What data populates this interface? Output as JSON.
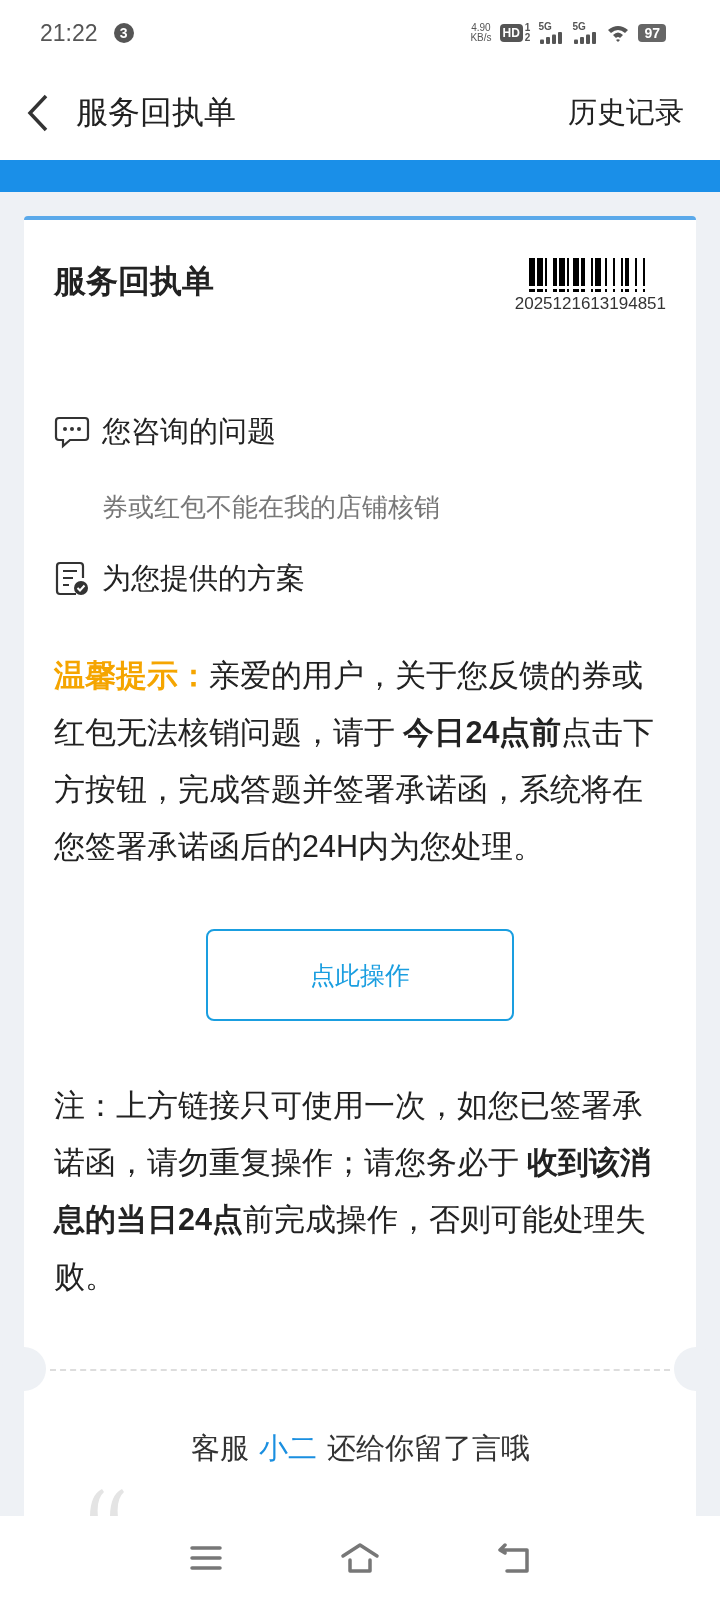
{
  "status_bar": {
    "time": "21:22",
    "notification_count": "3",
    "net_speed": "4.90",
    "net_unit": "KB/s",
    "hd": "HD",
    "sim_slots": [
      "1",
      "2"
    ],
    "networks": [
      "5G",
      "5G"
    ],
    "battery": "97"
  },
  "header": {
    "title": "服务回执单",
    "history_link": "历史记录"
  },
  "card": {
    "title": "服务回执单",
    "receipt_number": "2025121613194851",
    "sections": [
      {
        "kind": "question",
        "heading": "您咨询的问题",
        "answer": "券或红包不能在我的店铺核销"
      },
      {
        "kind": "solution",
        "heading": "为您提供的方案"
      }
    ],
    "tip": {
      "label": "温馨提示：",
      "text": "亲爱的用户，关于您反馈的券或红包无法核销问题，请于 **今日24点前**点击下方按钮，完成答题并签署承诺函，系统将在您签署承诺函后的24H内为您处理。"
    },
    "action_button": "点此操作",
    "note": "注：上方链接只可使用一次，如您已签署承诺函，请勿重复操作；请您务必于 **收到该消息的当日24点**前完成操作，否则可能处理失败。",
    "message": {
      "prefix": "客服",
      "agent": "小二",
      "suffix": "还给你留了言哦"
    }
  }
}
